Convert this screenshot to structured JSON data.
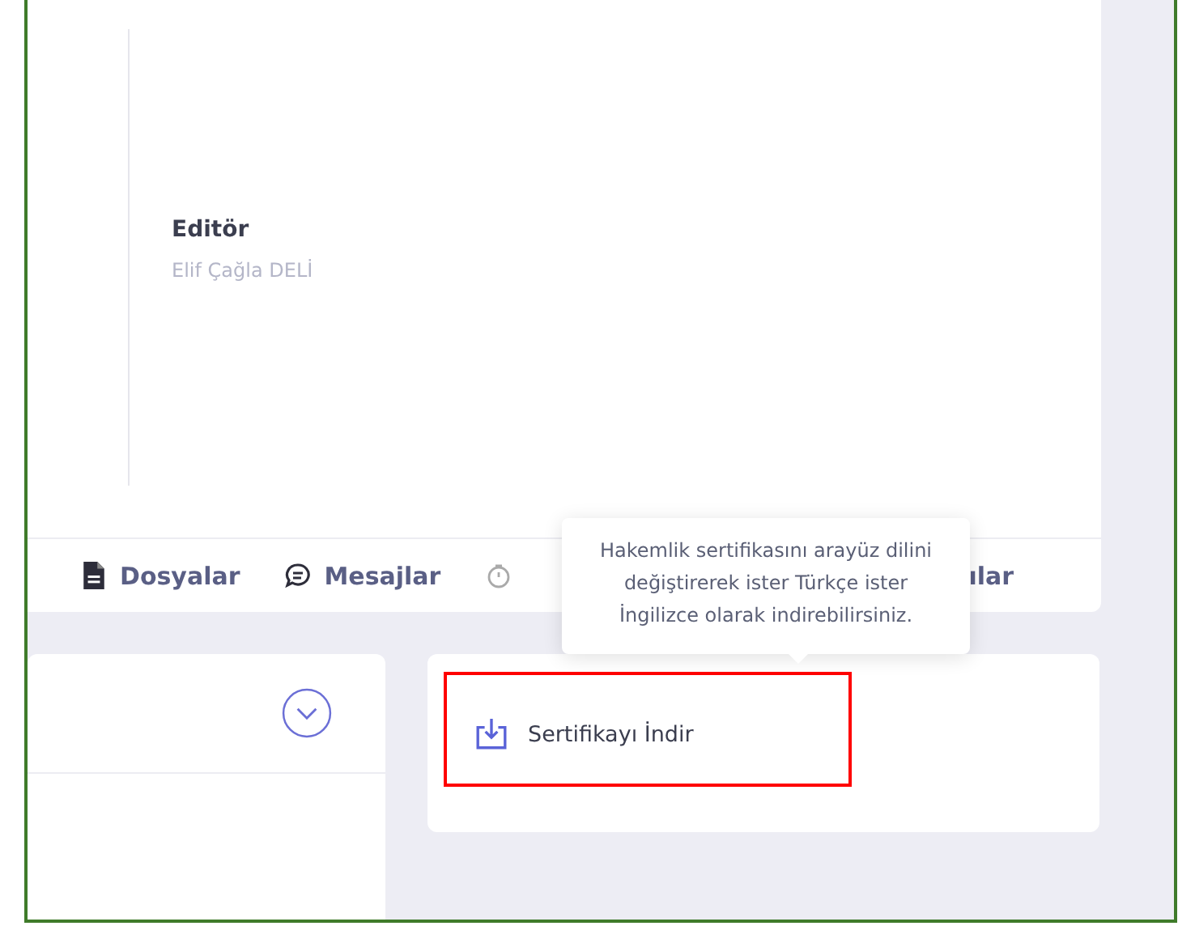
{
  "profile": {
    "role": "Editör",
    "name": "Elif Çağla DELİ"
  },
  "tabs": [
    {
      "kind": "file",
      "label": "Dosyalar"
    },
    {
      "kind": "chat",
      "label": "Mesajlar"
    },
    {
      "kind": "timer"
    },
    {
      "kind": "text",
      "label": "ılar"
    }
  ],
  "tooltip": "Hakemlik sertifikasını arayüz dilini değiştirerek ister Türkçe ister İngilizce olarak indirebilirsiniz.",
  "download": {
    "label": "Sertifikayı İndir",
    "highlighted": true
  }
}
